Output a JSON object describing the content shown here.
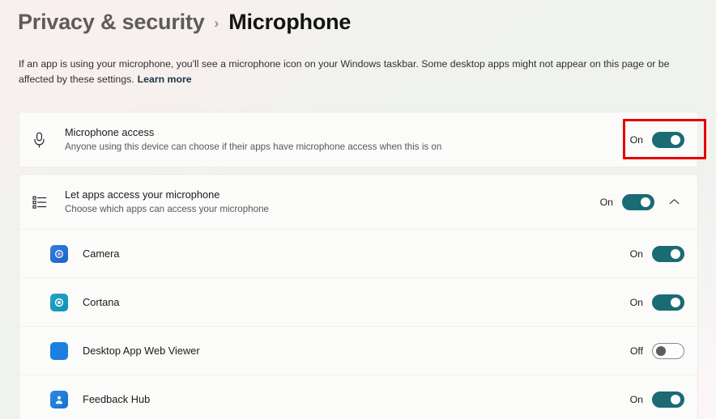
{
  "breadcrumb": {
    "parent": "Privacy & security",
    "separator": "›",
    "current": "Microphone"
  },
  "description": {
    "text": "If an app is using your microphone, you'll see a microphone icon on your Windows taskbar. Some desktop apps might not appear on this page or be affected by these settings.",
    "learn_more": "Learn more"
  },
  "colors": {
    "toggle_on": "#1a6b73",
    "highlight": "#e60000",
    "page_background": "#f0f2ee",
    "card_background": "#fbfbfa"
  },
  "settings": {
    "microphone_access": {
      "title": "Microphone access",
      "subtitle": "Anyone using this device can choose if their apps have microphone access when this is on",
      "state": "On",
      "icon": "microphone-icon",
      "highlighted": true
    },
    "let_apps_access": {
      "title": "Let apps access your microphone",
      "subtitle": "Choose which apps can access your microphone",
      "state": "On",
      "icon": "app-list-icon",
      "expanded": true,
      "chevron": "chevron-up-icon"
    }
  },
  "apps": [
    {
      "name": "Camera",
      "state": "On",
      "icon": "camera-app-icon"
    },
    {
      "name": "Cortana",
      "state": "On",
      "icon": "cortana-app-icon"
    },
    {
      "name": "Desktop App Web Viewer",
      "state": "Off",
      "icon": "desktop-app-web-viewer-icon"
    },
    {
      "name": "Feedback Hub",
      "state": "On",
      "icon": "feedback-hub-app-icon"
    }
  ]
}
